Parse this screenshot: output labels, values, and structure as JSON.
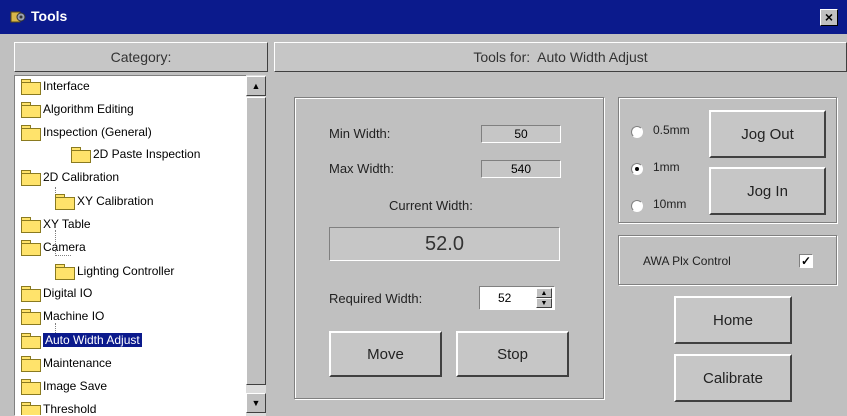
{
  "window": {
    "title": "Tools",
    "close_glyph": "×"
  },
  "category_header": "Category:",
  "tools_header": {
    "prefix": "Tools for:",
    "tool": "Auto Width Adjust"
  },
  "tree": [
    {
      "label": "Interface",
      "level": 0
    },
    {
      "label": "Algorithm Editing",
      "level": 0
    },
    {
      "label": "Inspection (General)",
      "level": 0
    },
    {
      "label": "2D Paste Inspection",
      "level": 1
    },
    {
      "label": "2D Calibration",
      "level": 0
    },
    {
      "label": "XY Calibration",
      "level": 1
    },
    {
      "label": "XY Table",
      "level": 0
    },
    {
      "label": "Camera",
      "level": 0
    },
    {
      "label": "Lighting Controller",
      "level": 1
    },
    {
      "label": "Digital IO",
      "level": 0
    },
    {
      "label": "Machine IO",
      "level": 0
    },
    {
      "label": "Auto Width Adjust",
      "level": 0,
      "selected": true
    },
    {
      "label": "Maintenance",
      "level": 0
    },
    {
      "label": "Image Save",
      "level": 0
    },
    {
      "label": "Threshold",
      "level": 0
    }
  ],
  "width_panel": {
    "min_label": "Min Width:",
    "min_value": "50",
    "max_label": "Max Width:",
    "max_value": "540",
    "current_label": "Current Width:",
    "current_value": "52.0",
    "required_label": "Required Width:",
    "required_value": "52",
    "move_label": "Move",
    "stop_label": "Stop"
  },
  "jog_panel": {
    "options": [
      {
        "label": "0.5mm",
        "selected": false
      },
      {
        "label": "1mm",
        "selected": true
      },
      {
        "label": "10mm",
        "selected": false
      }
    ],
    "jog_out_label": "Jog Out",
    "jog_in_label": "Jog In"
  },
  "plx_panel": {
    "label": "AWA Plx Control",
    "checked": true,
    "check_glyph": "✓"
  },
  "home_label": "Home",
  "calibrate_label": "Calibrate",
  "scroll": {
    "up_glyph": "▲",
    "down_glyph": "▼"
  },
  "colors": {
    "titlebar": "#0b1a8c",
    "face": "#c0c0c0",
    "selection": "#0b1a8c",
    "folder": "#ffe36b"
  }
}
